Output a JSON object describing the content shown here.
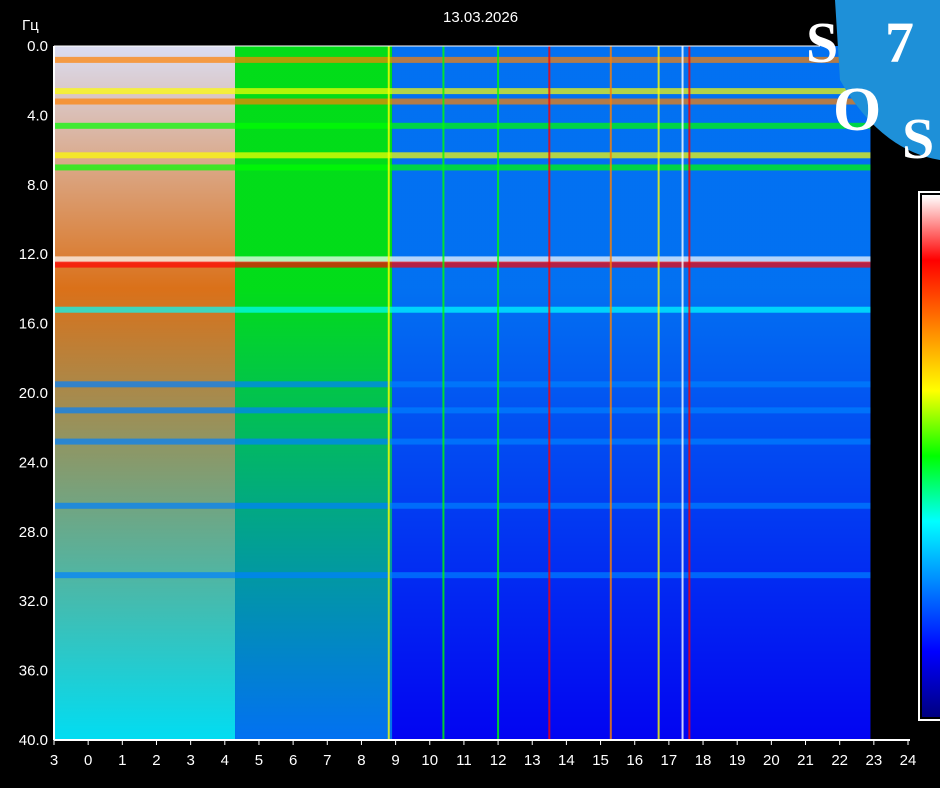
{
  "chart_data": {
    "type": "heatmap",
    "title": "13.03.2026",
    "ylabel": "Гц",
    "xlabel": "",
    "x_ticks": [
      "3",
      "0",
      "1",
      "2",
      "3",
      "4",
      "5",
      "6",
      "7",
      "8",
      "9",
      "10",
      "11",
      "12",
      "13",
      "14",
      "15",
      "16",
      "17",
      "18",
      "19",
      "20",
      "21",
      "22",
      "23",
      "24"
    ],
    "xlim": [
      -1,
      24
    ],
    "y_ticks": [
      "0.0",
      "4.0",
      "8.0",
      "12.0",
      "16.0",
      "20.0",
      "24.0",
      "28.0",
      "32.0",
      "36.0",
      "40.0"
    ],
    "ylim": [
      0,
      40
    ],
    "y_reversed": true,
    "grid": false,
    "colorscale": [
      "#000080",
      "#0000ff",
      "#0080ff",
      "#00ffff",
      "#00ff00",
      "#ffff00",
      "#ff8000",
      "#ff0000",
      "#ffffff"
    ],
    "background_color": "#0a1aa8",
    "data_end_hour": 22.9,
    "bands_hz": [
      {
        "freq": 0.8,
        "strength": 0.75
      },
      {
        "freq": 2.6,
        "strength": 0.65
      },
      {
        "freq": 3.2,
        "strength": 0.8
      },
      {
        "freq": 4.6,
        "strength": 0.55
      },
      {
        "freq": 6.3,
        "strength": 0.6
      },
      {
        "freq": 7.0,
        "strength": 0.55
      },
      {
        "freq": 12.3,
        "strength": 0.95
      },
      {
        "freq": 12.6,
        "strength": 0.85
      },
      {
        "freq": 15.2,
        "strength": 0.35
      },
      {
        "freq": 19.5,
        "strength": 0.3
      },
      {
        "freq": 21.0,
        "strength": 0.3
      },
      {
        "freq": 22.8,
        "strength": 0.3
      },
      {
        "freq": 26.5,
        "strength": 0.25
      },
      {
        "freq": 30.5,
        "strength": 0.25
      }
    ],
    "vertical_lines_hours": [
      {
        "hour": 13.5,
        "strength": 0.9
      },
      {
        "hour": 15.3,
        "strength": 0.7
      },
      {
        "hour": 17.4,
        "strength": 1.0
      },
      {
        "hour": 17.6,
        "strength": 0.9
      },
      {
        "hour": 12.0,
        "strength": 0.5
      },
      {
        "hour": 10.4,
        "strength": 0.5
      },
      {
        "hour": 16.7,
        "strength": 0.6
      },
      {
        "hour": 8.8,
        "strength": 0.6
      }
    ],
    "activity_zones": [
      {
        "from_hour": -1,
        "to_hour": 4.3,
        "intensity": 1.0
      },
      {
        "from_hour": 4.3,
        "to_hour": 8.9,
        "intensity": 0.55
      },
      {
        "from_hour": 8.9,
        "to_hour": 23,
        "intensity": 0.3
      }
    ]
  },
  "logo": {
    "letters": [
      "S",
      "7",
      "O",
      "S"
    ],
    "color": "#1e90d8"
  }
}
